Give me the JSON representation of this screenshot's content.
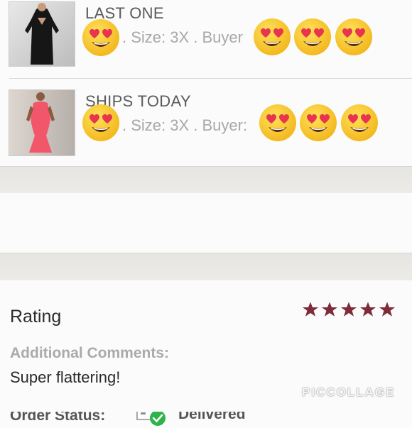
{
  "items": [
    {
      "title": "LAST ONE",
      "meta": ". Size: 3X . Buyer",
      "image_icon": "black-dress-photo"
    },
    {
      "title": "SHIPS TODAY",
      "meta": ". Size: 3X . Buyer:",
      "image_icon": "coral-dress-photo"
    }
  ],
  "order_status": {
    "label": "Order Status:",
    "value": "Delivered",
    "icon": "delivered-box-check-icon"
  },
  "rating": {
    "label": "Rating",
    "stars": 5,
    "star_color": "#7e2b3a"
  },
  "comments": {
    "label": "Additional Comments:",
    "text": "Super flattering!"
  },
  "overlay": {
    "emoji": "heart-eyes-emoji",
    "watermark": "PICCOLLAGE"
  },
  "colors": {
    "status_check": "#2db34a",
    "band": "#e8e7e3"
  }
}
